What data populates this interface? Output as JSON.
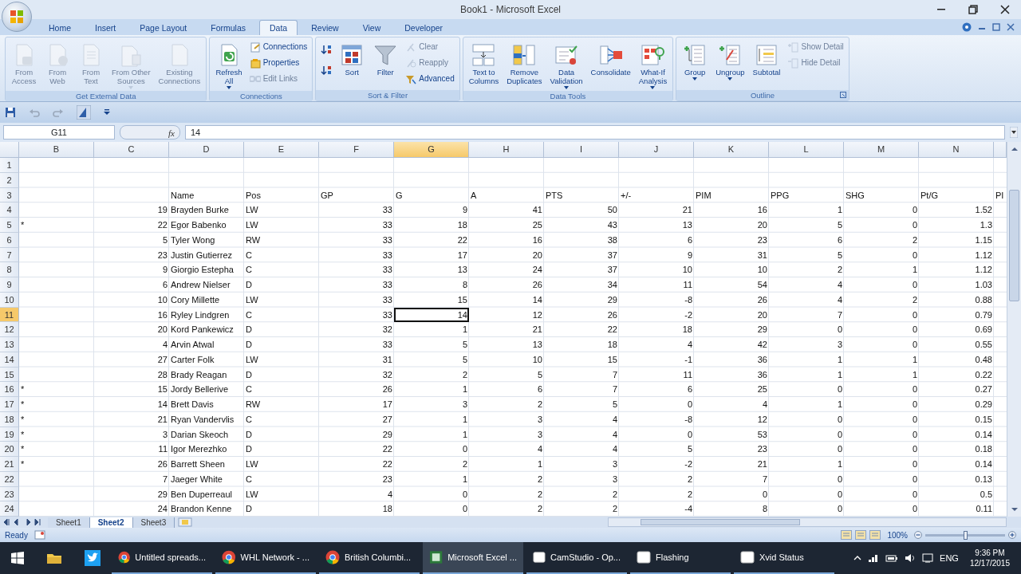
{
  "window": {
    "title": "Book1 - Microsoft Excel"
  },
  "ribbon_tabs": [
    {
      "label": "Home",
      "selected": false
    },
    {
      "label": "Insert",
      "selected": false
    },
    {
      "label": "Page Layout",
      "selected": false
    },
    {
      "label": "Formulas",
      "selected": false
    },
    {
      "label": "Data",
      "selected": true
    },
    {
      "label": "Review",
      "selected": false
    },
    {
      "label": "View",
      "selected": false
    },
    {
      "label": "Developer",
      "selected": false
    }
  ],
  "ribbon_groups": [
    {
      "label": "Get External Data",
      "buttons": [
        {
          "kind": "large",
          "label": "From\nAccess",
          "disabled": true
        },
        {
          "kind": "large",
          "label": "From\nWeb",
          "disabled": true
        },
        {
          "kind": "large",
          "label": "From\nText",
          "disabled": true
        },
        {
          "kind": "large",
          "label": "From Other\nSources",
          "disabled": true,
          "has_menu": true
        },
        {
          "kind": "large",
          "label": "Existing\nConnections",
          "disabled": true
        }
      ]
    },
    {
      "label": "Connections",
      "buttons": [
        {
          "kind": "large",
          "label": "Refresh\nAll",
          "disabled": false,
          "has_menu": true
        },
        {
          "kind": "small",
          "label": "Connections",
          "disabled": false
        },
        {
          "kind": "small",
          "label": "Properties",
          "disabled": false
        },
        {
          "kind": "small",
          "label": "Edit Links",
          "disabled": true
        }
      ]
    },
    {
      "label": "Sort & Filter",
      "buttons": [
        {
          "kind": "icon",
          "disabled": false
        },
        {
          "kind": "icon",
          "disabled": false
        },
        {
          "kind": "large",
          "label": "Sort",
          "disabled": false
        },
        {
          "kind": "large",
          "label": "Filter",
          "disabled": false
        },
        {
          "kind": "small",
          "label": "Clear",
          "disabled": true
        },
        {
          "kind": "small",
          "label": "Reapply",
          "disabled": true
        },
        {
          "kind": "small",
          "label": "Advanced",
          "disabled": false
        }
      ]
    },
    {
      "label": "Data Tools",
      "buttons": [
        {
          "kind": "large",
          "label": "Text to\nColumns",
          "disabled": false
        },
        {
          "kind": "large",
          "label": "Remove\nDuplicates",
          "disabled": false
        },
        {
          "kind": "large",
          "label": "Data\nValidation",
          "disabled": false,
          "has_menu": true
        },
        {
          "kind": "large",
          "label": "Consolidate",
          "disabled": false
        },
        {
          "kind": "large",
          "label": "What-If\nAnalysis",
          "disabled": false,
          "has_menu": true
        }
      ]
    },
    {
      "label": "Outline",
      "buttons": [
        {
          "kind": "large",
          "label": "Group",
          "disabled": false,
          "has_menu": true
        },
        {
          "kind": "large",
          "label": "Ungroup",
          "disabled": false,
          "has_menu": true
        },
        {
          "kind": "large",
          "label": "Subtotal",
          "disabled": false
        },
        {
          "kind": "small",
          "label": "Show Detail",
          "disabled": true
        },
        {
          "kind": "small",
          "label": "Hide Detail",
          "disabled": true
        }
      ]
    }
  ],
  "formula_bar": {
    "name_box": "G11",
    "function_label": "fx",
    "formula": "14"
  },
  "columns": [
    {
      "label": "B",
      "selected": false
    },
    {
      "label": "C",
      "selected": false
    },
    {
      "label": "D",
      "selected": false
    },
    {
      "label": "E",
      "selected": false
    },
    {
      "label": "F",
      "selected": false
    },
    {
      "label": "G",
      "selected": true
    },
    {
      "label": "H",
      "selected": false
    },
    {
      "label": "I",
      "selected": false
    },
    {
      "label": "J",
      "selected": false
    },
    {
      "label": "K",
      "selected": false
    },
    {
      "label": "L",
      "selected": false
    },
    {
      "label": "M",
      "selected": false
    },
    {
      "label": "N",
      "selected": false
    }
  ],
  "rows": [
    {
      "number": "1",
      "selected": false,
      "kind": "empty"
    },
    {
      "number": "2",
      "selected": false,
      "kind": "empty"
    },
    {
      "number": "3",
      "selected": false,
      "kind": "header",
      "labels": [
        "Name",
        "Pos",
        "GP",
        "G",
        "A",
        "PTS",
        "+/-",
        "PIM",
        "PPG",
        "SHG",
        "Pt/G",
        "PI"
      ]
    },
    {
      "number": "4",
      "selected": false,
      "kind": "player",
      "jersey": "19",
      "name": "Brayden Burke",
      "pos": "LW",
      "stats": [
        "33",
        "9",
        "41",
        "50",
        "21",
        "16",
        "1",
        "0",
        "1.52"
      ]
    },
    {
      "number": "5",
      "selected": false,
      "kind": "player",
      "mark": "*",
      "jersey": "22",
      "name": "Egor Babenko",
      "pos": "LW",
      "stats": [
        "33",
        "18",
        "25",
        "43",
        "13",
        "20",
        "5",
        "0",
        "1.3"
      ]
    },
    {
      "number": "6",
      "selected": false,
      "kind": "player",
      "jersey": "5",
      "name": "Tyler Wong",
      "pos": "RW",
      "stats": [
        "33",
        "22",
        "16",
        "38",
        "6",
        "23",
        "6",
        "2",
        "1.15"
      ]
    },
    {
      "number": "7",
      "selected": false,
      "kind": "player",
      "jersey": "23",
      "name": "Justin Gutierrez",
      "pos": "C",
      "stats": [
        "33",
        "17",
        "20",
        "37",
        "9",
        "31",
        "5",
        "0",
        "1.12"
      ]
    },
    {
      "number": "8",
      "selected": false,
      "kind": "player",
      "jersey": "9",
      "name": "Giorgio Estepha",
      "pos": "C",
      "stats": [
        "33",
        "13",
        "24",
        "37",
        "10",
        "10",
        "2",
        "1",
        "1.12"
      ]
    },
    {
      "number": "9",
      "selected": false,
      "kind": "player",
      "jersey": "6",
      "name": "Andrew Nielser",
      "pos": "D",
      "stats": [
        "33",
        "8",
        "26",
        "34",
        "11",
        "54",
        "4",
        "0",
        "1.03"
      ]
    },
    {
      "number": "10",
      "selected": false,
      "kind": "player",
      "jersey": "10",
      "name": "Cory Millette",
      "pos": "LW",
      "stats": [
        "33",
        "15",
        "14",
        "29",
        "-8",
        "26",
        "4",
        "2",
        "0.88"
      ]
    },
    {
      "number": "11",
      "selected": true,
      "kind": "player",
      "jersey": "16",
      "name": "Ryley Lindgren",
      "pos": "C",
      "stats": [
        "33",
        "14",
        "12",
        "26",
        "-2",
        "20",
        "7",
        "0",
        "0.79"
      ]
    },
    {
      "number": "12",
      "selected": false,
      "kind": "player",
      "jersey": "20",
      "name": "Kord Pankewicz",
      "pos": "D",
      "stats": [
        "32",
        "1",
        "21",
        "22",
        "18",
        "29",
        "0",
        "0",
        "0.69"
      ]
    },
    {
      "number": "13",
      "selected": false,
      "kind": "player",
      "jersey": "4",
      "name": "Arvin Atwal",
      "pos": "D",
      "stats": [
        "33",
        "5",
        "13",
        "18",
        "4",
        "42",
        "3",
        "0",
        "0.55"
      ]
    },
    {
      "number": "14",
      "selected": false,
      "kind": "player",
      "jersey": "27",
      "name": "Carter Folk",
      "pos": "LW",
      "stats": [
        "31",
        "5",
        "10",
        "15",
        "-1",
        "36",
        "1",
        "1",
        "0.48"
      ]
    },
    {
      "number": "15",
      "selected": false,
      "kind": "player",
      "jersey": "28",
      "name": "Brady Reagan",
      "pos": "D",
      "stats": [
        "32",
        "2",
        "5",
        "7",
        "11",
        "36",
        "1",
        "1",
        "0.22"
      ]
    },
    {
      "number": "16",
      "selected": false,
      "kind": "player",
      "mark": "*",
      "jersey": "15",
      "name": "Jordy Bellerive",
      "pos": "C",
      "stats": [
        "26",
        "1",
        "6",
        "7",
        "6",
        "25",
        "0",
        "0",
        "0.27"
      ]
    },
    {
      "number": "17",
      "selected": false,
      "kind": "player",
      "mark": "*",
      "jersey": "14",
      "name": "Brett Davis",
      "pos": "RW",
      "stats": [
        "17",
        "3",
        "2",
        "5",
        "0",
        "4",
        "1",
        "0",
        "0.29"
      ]
    },
    {
      "number": "18",
      "selected": false,
      "kind": "player",
      "mark": "*",
      "jersey": "21",
      "name": "Ryan Vandervlis",
      "pos": "C",
      "stats": [
        "27",
        "1",
        "3",
        "4",
        "-8",
        "12",
        "0",
        "0",
        "0.15"
      ]
    },
    {
      "number": "19",
      "selected": false,
      "kind": "player",
      "mark": "*",
      "jersey": "3",
      "name": "Darian Skeoch",
      "pos": "D",
      "stats": [
        "29",
        "1",
        "3",
        "4",
        "0",
        "53",
        "0",
        "0",
        "0.14"
      ]
    },
    {
      "number": "20",
      "selected": false,
      "kind": "player",
      "mark": "*",
      "jersey": "11",
      "name": "Igor Merezhko",
      "pos": "D",
      "stats": [
        "22",
        "0",
        "4",
        "4",
        "5",
        "23",
        "0",
        "0",
        "0.18"
      ]
    },
    {
      "number": "21",
      "selected": false,
      "kind": "player",
      "mark": "*",
      "jersey": "26",
      "name": "Barrett Sheen",
      "pos": "LW",
      "stats": [
        "22",
        "2",
        "1",
        "3",
        "-2",
        "21",
        "1",
        "0",
        "0.14"
      ]
    },
    {
      "number": "22",
      "selected": false,
      "kind": "player",
      "jersey": "7",
      "name": "Jaeger White",
      "pos": "C",
      "stats": [
        "23",
        "1",
        "2",
        "3",
        "2",
        "7",
        "0",
        "0",
        "0.13"
      ]
    },
    {
      "number": "23",
      "selected": false,
      "kind": "player",
      "jersey": "29",
      "name": "Ben Duperreaul",
      "pos": "LW",
      "stats": [
        "4",
        "0",
        "2",
        "2",
        "2",
        "0",
        "0",
        "0",
        "0.5"
      ]
    },
    {
      "number": "24",
      "selected": false,
      "kind": "player",
      "jersey": "24",
      "name": "Brandon Kenne",
      "pos": "D",
      "stats": [
        "18",
        "0",
        "2",
        "2",
        "-4",
        "8",
        "0",
        "0",
        "0.11"
      ]
    }
  ],
  "sheet_tabs": [
    {
      "label": "Sheet1",
      "selected": false
    },
    {
      "label": "Sheet2",
      "selected": true
    },
    {
      "label": "Sheet3",
      "selected": false
    }
  ],
  "status_bar": {
    "text": "Ready",
    "zoom": "100%",
    "zoom_slider": {
      "level": 0.5
    }
  },
  "taskbar": {
    "items": [
      {
        "kind": "chrome",
        "label": "Untitled spreads...",
        "selected": false
      },
      {
        "kind": "chrome",
        "label": "WHL Network - ...",
        "selected": false
      },
      {
        "kind": "chrome",
        "label": "British Columbi...",
        "selected": false
      },
      {
        "kind": "excel",
        "label": "Microsoft Excel ...",
        "selected": true
      },
      {
        "kind": "app",
        "label": "CamStudio - Op...",
        "selected": false
      },
      {
        "kind": "app",
        "label": "Flashing",
        "selected": false
      },
      {
        "kind": "app",
        "label": "Xvid Status",
        "selected": false
      }
    ],
    "language": "ENG",
    "time": "9:36 PM",
    "date": "12/17/2015"
  }
}
